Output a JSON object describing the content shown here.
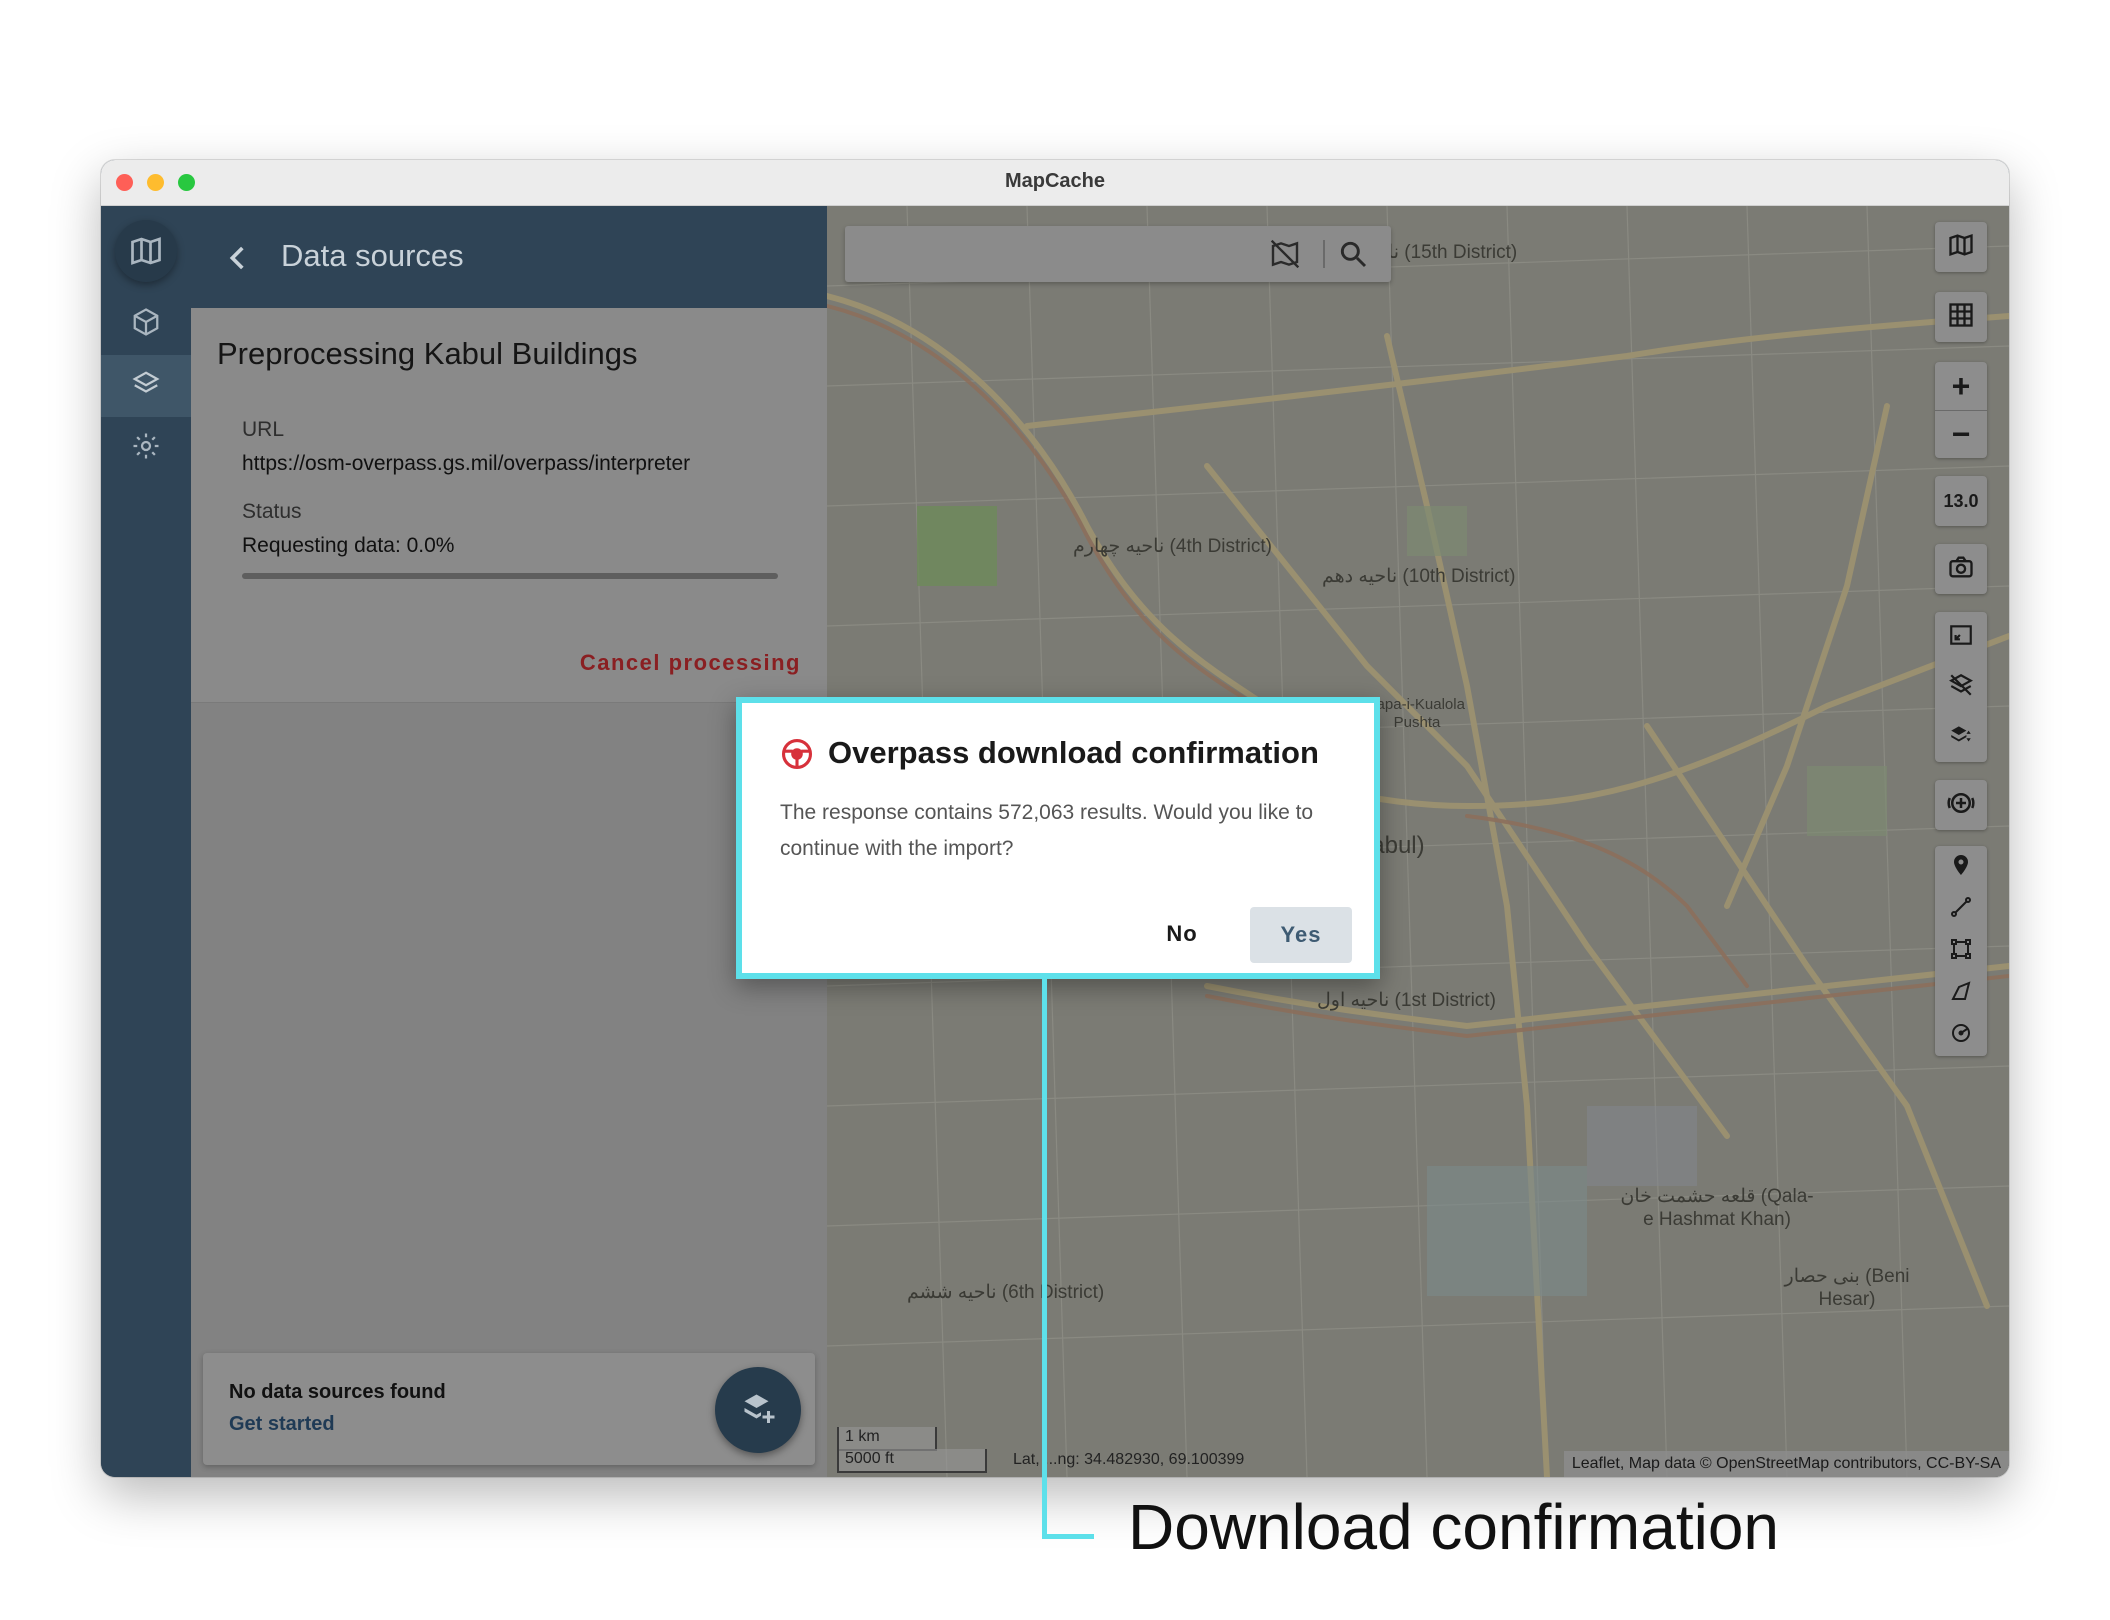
{
  "window": {
    "title": "MapCache"
  },
  "sidebar": {
    "items": [
      {
        "name": "logo",
        "icon": "map-logo-icon"
      },
      {
        "name": "projects",
        "icon": "cube-icon"
      },
      {
        "name": "data-sources",
        "icon": "layers-icon",
        "active": true
      },
      {
        "name": "settings",
        "icon": "gear-icon"
      }
    ]
  },
  "panel": {
    "header_title": "Data sources",
    "processing_title": "Preprocessing Kabul Buildings",
    "url_label": "URL",
    "url_value": "https://osm-overpass.gs.mil/overpass/interpreter",
    "status_label": "Status",
    "status_value": "Requesting data: 0.0%",
    "progress": 0.0,
    "cancel_label": "Cancel processing",
    "no_data_text": "No data sources found",
    "get_started_label": "Get started"
  },
  "map": {
    "zoom_level": "13.0",
    "scale_km": "1 km",
    "scale_ft": "5000 ft",
    "latlng_text": "Lat, ...ng: 34.482930, 69.100399",
    "attribution": "Leaflet, Map data © OpenStreetMap contributors, CC-BY-SA",
    "labels": [
      "ناحیه پانزدهم (15th District)",
      "ناحیه چهارم (4th District)",
      "ناحیه دهم (10th District)",
      "کابل (Kabul)",
      "ناحیه اول (1st District)",
      "ناحیه ششم (6th District)",
      "قلعه حشمت خان (Qala-e Hashmat Khan)",
      "بنی حصار (Beni Hesar)",
      "Tapa-i-Kualola Pushta"
    ]
  },
  "dialog": {
    "title": "Overpass download confirmation",
    "message": "The response contains 572,063 results. Would you like to continue with the import?",
    "no_label": "No",
    "yes_label": "Yes",
    "border_color": "#5de0ea"
  },
  "callout": {
    "text": "Download confirmation"
  }
}
